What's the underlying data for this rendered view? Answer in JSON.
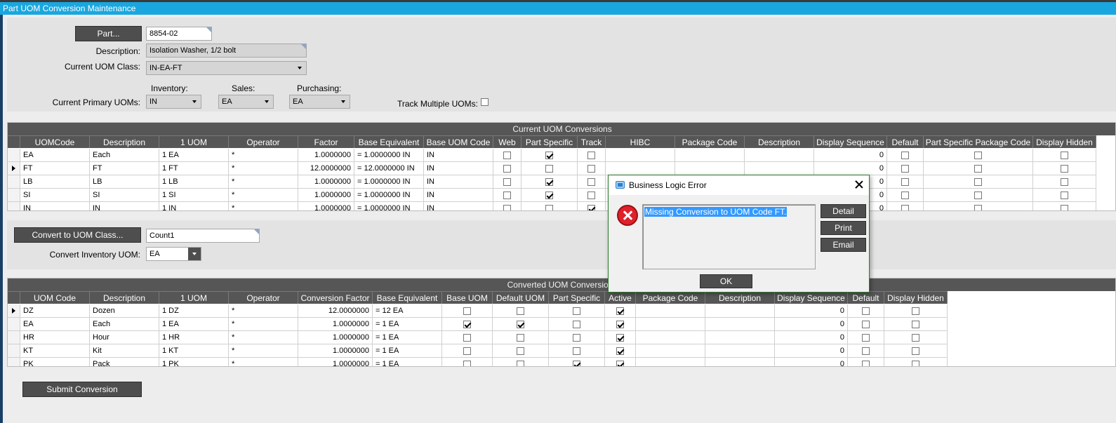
{
  "window": {
    "title": "Part UOM Conversion Maintenance"
  },
  "form": {
    "part_button": "Part...",
    "part_value": "8854-02",
    "description_label": "Description:",
    "description_value": "Isolation Washer, 1/2 bolt",
    "uom_class_label": "Current UOM Class:",
    "uom_class_value": "IN-EA-FT",
    "inventory_label": "Inventory:",
    "sales_label": "Sales:",
    "purchasing_label": "Purchasing:",
    "primary_uoms_label": "Current Primary UOMs:",
    "inventory_value": "IN",
    "sales_value": "EA",
    "purchasing_value": "EA",
    "track_multiple_label": "Track Multiple UOMs:",
    "track_multiple_checked": false
  },
  "current_grid": {
    "caption": "Current UOM Conversions",
    "columns": [
      "UOMCode",
      "Description",
      "1 UOM",
      "Operator",
      "Factor",
      "Base Equivalent",
      "Base UOM Code",
      "Web",
      "Part Specific",
      "Track",
      "HIBC",
      "Package Code",
      "Description",
      "Display Sequence",
      "Default",
      "Part Specific Package Code",
      "Display Hidden"
    ],
    "rows": [
      {
        "code": "EA",
        "desc": "Each",
        "one": "1 EA",
        "op": "*",
        "factor": "1.0000000",
        "base": "= 1.0000000 IN",
        "baseuom": "IN",
        "web": false,
        "ps": true,
        "track": false,
        "seq": "0",
        "def": false,
        "pspc": false,
        "hidden": false,
        "sel": false
      },
      {
        "code": "FT",
        "desc": "FT",
        "one": "1 FT",
        "op": "*",
        "factor": "12.0000000",
        "base": "= 12.0000000 IN",
        "baseuom": "IN",
        "web": false,
        "ps": false,
        "track": false,
        "seq": "0",
        "def": false,
        "pspc": false,
        "hidden": false,
        "sel": true
      },
      {
        "code": "LB",
        "desc": "LB",
        "one": "1 LB",
        "op": "*",
        "factor": "1.0000000",
        "base": "= 1.0000000 IN",
        "baseuom": "IN",
        "web": false,
        "ps": true,
        "track": false,
        "seq": "0",
        "def": false,
        "pspc": false,
        "hidden": false,
        "sel": false
      },
      {
        "code": "SI",
        "desc": "SI",
        "one": "1 SI",
        "op": "*",
        "factor": "1.0000000",
        "base": "= 1.0000000 IN",
        "baseuom": "IN",
        "web": false,
        "ps": true,
        "track": false,
        "seq": "0",
        "def": false,
        "pspc": false,
        "hidden": false,
        "sel": false
      },
      {
        "code": "IN",
        "desc": "IN",
        "one": "1 IN",
        "op": "*",
        "factor": "1.0000000",
        "base": "= 1.0000000 IN",
        "baseuom": "IN",
        "web": false,
        "ps": false,
        "track": true,
        "seq": "0",
        "def": false,
        "pspc": false,
        "hidden": false,
        "sel": false
      }
    ]
  },
  "convert": {
    "button": "Convert to UOM Class...",
    "class_value": "Count1",
    "inv_uom_label": "Convert Inventory UOM:",
    "inv_uom_value": "EA"
  },
  "converted_grid": {
    "caption": "Converted UOM Conversions",
    "columns": [
      "UOM Code",
      "Description",
      "1 UOM",
      "Operator",
      "Conversion Factor",
      "Base Equivalent",
      "Base UOM",
      "Default UOM",
      "Part Specific",
      "Active",
      "Package Code",
      "Description",
      "Display Sequence",
      "Default",
      "Display Hidden"
    ],
    "rows": [
      {
        "code": "DZ",
        "desc": "Dozen",
        "one": "1 DZ",
        "op": "*",
        "factor": "12.0000000",
        "base": "= 12 EA",
        "baseuom": false,
        "defuom": false,
        "ps": false,
        "active": true,
        "seq": "0",
        "def": false,
        "hidden": false,
        "sel": true
      },
      {
        "code": "EA",
        "desc": "Each",
        "one": "1 EA",
        "op": "*",
        "factor": "1.0000000",
        "base": "= 1 EA",
        "baseuom": true,
        "defuom": true,
        "ps": false,
        "active": true,
        "seq": "0",
        "def": false,
        "hidden": false,
        "sel": false
      },
      {
        "code": "HR",
        "desc": "Hour",
        "one": "1 HR",
        "op": "*",
        "factor": "1.0000000",
        "base": "= 1 EA",
        "baseuom": false,
        "defuom": false,
        "ps": false,
        "active": true,
        "seq": "0",
        "def": false,
        "hidden": false,
        "sel": false
      },
      {
        "code": "KT",
        "desc": "Kit",
        "one": "1 KT",
        "op": "*",
        "factor": "1.0000000",
        "base": "= 1 EA",
        "baseuom": false,
        "defuom": false,
        "ps": false,
        "active": true,
        "seq": "0",
        "def": false,
        "hidden": false,
        "sel": false
      },
      {
        "code": "PK",
        "desc": "Pack",
        "one": "1 PK",
        "op": "*",
        "factor": "1.0000000",
        "base": "= 1 EA",
        "baseuom": false,
        "defuom": false,
        "ps": true,
        "active": true,
        "seq": "0",
        "def": false,
        "hidden": false,
        "sel": false
      }
    ]
  },
  "submit_button": "Submit Conversion",
  "dialog": {
    "title": "Business Logic Error",
    "message": "Missing Conversion to UOM Code FT.",
    "detail_button": "Detail",
    "print_button": "Print",
    "email_button": "Email",
    "ok_button": "OK"
  },
  "colors": {
    "titlebar": "#1aa7df",
    "button": "#4e4e4e",
    "grid_header": "#565656",
    "selection": "#3399ff"
  }
}
